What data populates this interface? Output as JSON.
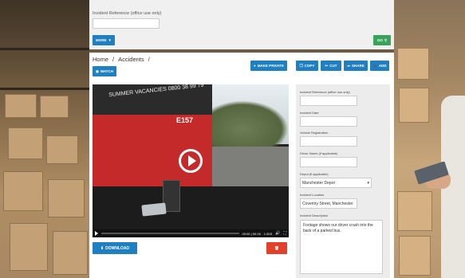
{
  "top_panel": {
    "ref_label": "Incident Reference (office use only)",
    "ref_value": "",
    "more_label": "MORE",
    "go_label": "GO"
  },
  "breadcrumb": [
    "Home",
    "/",
    "Accidents",
    "/"
  ],
  "toolbar": {
    "watch": "WATCH",
    "make_private": "MAKE PRIVATE",
    "copy": "COPY",
    "cut": "CUT",
    "share": "SHARE",
    "add": "ADD"
  },
  "video": {
    "bus_text": "SUMMER VACANCIES  0800 38 99 79",
    "bus_number": "E157",
    "time": "00:00 | 00:16",
    "speed": "1.00X",
    "progress": 0
  },
  "actions": {
    "download": "DOWNLOAD",
    "delete_icon": "trash-icon"
  },
  "form": {
    "ref_label": "Incident Reference (office use only)",
    "ref_value": "",
    "date_label": "Incident Date",
    "date_value": "",
    "vehicle_label": "Vehicle Registration",
    "vehicle_value": "",
    "driver_label": "Driver Name (if applicable)",
    "driver_value": "",
    "depot_label": "Depot (if applicable)",
    "depot_value": "Manchester Depot",
    "location_label": "Incident Location",
    "location_value": "Coventry Street, Manchester",
    "description_label": "Incident Description",
    "description_value": "Footage shows our driver crash into the back of a parked bus."
  },
  "colors": {
    "primary": "#1f7fc1",
    "success": "#3aa35b",
    "danger": "#e2402b"
  }
}
